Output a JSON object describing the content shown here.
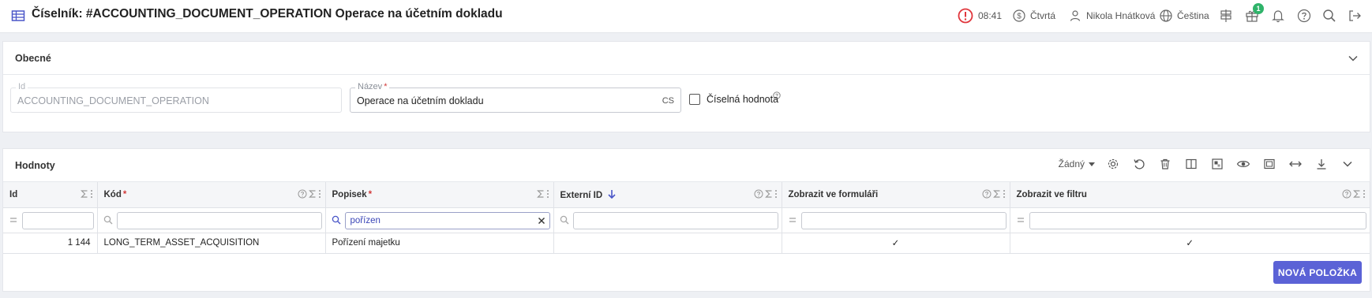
{
  "header": {
    "title": "Číselník: #ACCOUNTING_DOCUMENT_OPERATION Operace na účetním dokladu",
    "time": "08:41",
    "day": "Čtvrtá",
    "user": "Nikola Hnátková",
    "language": "Čeština",
    "gift_badge": "1"
  },
  "general": {
    "section_title": "Obecné",
    "id_label": "Id",
    "id_value": "ACCOUNTING_DOCUMENT_OPERATION",
    "name_label": "Název",
    "name_value": "Operace na účetním dokladu",
    "name_lang": "CS",
    "numeric_label": "Číselná hodnota"
  },
  "values": {
    "section_title": "Hodnoty",
    "view_select": "Žádný",
    "columns": [
      "Id",
      "Kód",
      "Popisek",
      "Externí ID",
      "Zobrazit ve formuláři",
      "Zobrazit ve filtru"
    ],
    "filter_popisek": "pořízen",
    "rows": [
      {
        "id": "1 144",
        "kod": "LONG_TERM_ASSET_ACQUISITION",
        "popisek": "Pořízení majetku",
        "externi_id": "",
        "form": "✓",
        "filter": "✓"
      }
    ],
    "new_button": "NOVÁ POLOŽKA"
  },
  "colors": {
    "accent": "#5b62d6",
    "alert": "#e0353b",
    "badge": "#2fb36a"
  }
}
